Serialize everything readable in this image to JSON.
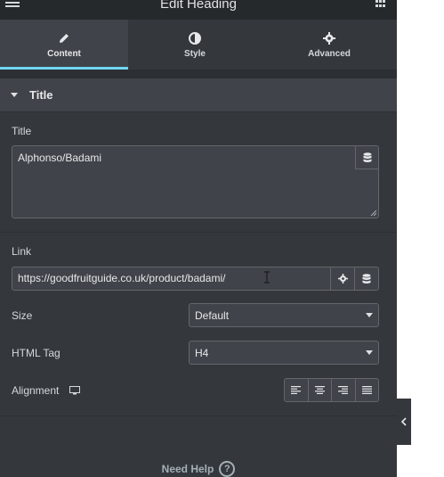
{
  "header": {
    "title": "Edit Heading"
  },
  "tabs": [
    {
      "label": "Content",
      "icon": "pencil-icon"
    },
    {
      "label": "Style",
      "icon": "half-circle-icon"
    },
    {
      "label": "Advanced",
      "icon": "gear-icon"
    }
  ],
  "section": {
    "title": "Title"
  },
  "title_control": {
    "label": "Title",
    "value": "Alphonso/Badami"
  },
  "link_control": {
    "label": "Link",
    "value": "https://goodfruitguide.co.uk/product/badami/"
  },
  "size_control": {
    "label": "Size",
    "value": "Default"
  },
  "html_tag_control": {
    "label": "HTML Tag",
    "value": "H4"
  },
  "alignment_control": {
    "label": "Alignment"
  },
  "footer": {
    "need_help": "Need Help",
    "help_symbol": "?"
  },
  "colors": {
    "accent": "#71d7f7",
    "panel": "#34383c",
    "header": "#26292c"
  }
}
